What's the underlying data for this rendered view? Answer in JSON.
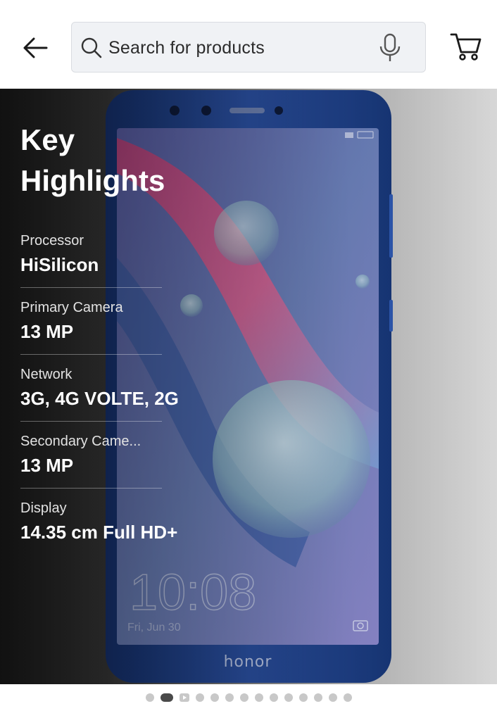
{
  "header": {
    "back_icon": "arrow-left-icon",
    "search": {
      "placeholder": "Search for products",
      "icon": "search-icon",
      "mic_icon": "microphone-icon"
    },
    "cart_icon": "shopping-cart-icon"
  },
  "hero": {
    "title": "Key Highlights",
    "phone": {
      "brand": "honor",
      "clock": "10:08",
      "date": "Fri, Jun 30"
    },
    "specs": [
      {
        "label": "Processor",
        "value": "HiSilicon"
      },
      {
        "label": "Primary Camera",
        "value": "13 MP"
      },
      {
        "label": "Network",
        "value": "3G, 4G VOLTE, 2G"
      },
      {
        "label": "Secondary Came...",
        "value": "13 MP"
      },
      {
        "label": "Display",
        "value": "14.35 cm Full HD+"
      }
    ]
  },
  "pager": {
    "total": 14,
    "active_index": 1,
    "video_index": 2
  },
  "colors": {
    "phone_body": "#1f3f86",
    "screen_pink": "#e0407a",
    "text_white": "#ffffff"
  }
}
